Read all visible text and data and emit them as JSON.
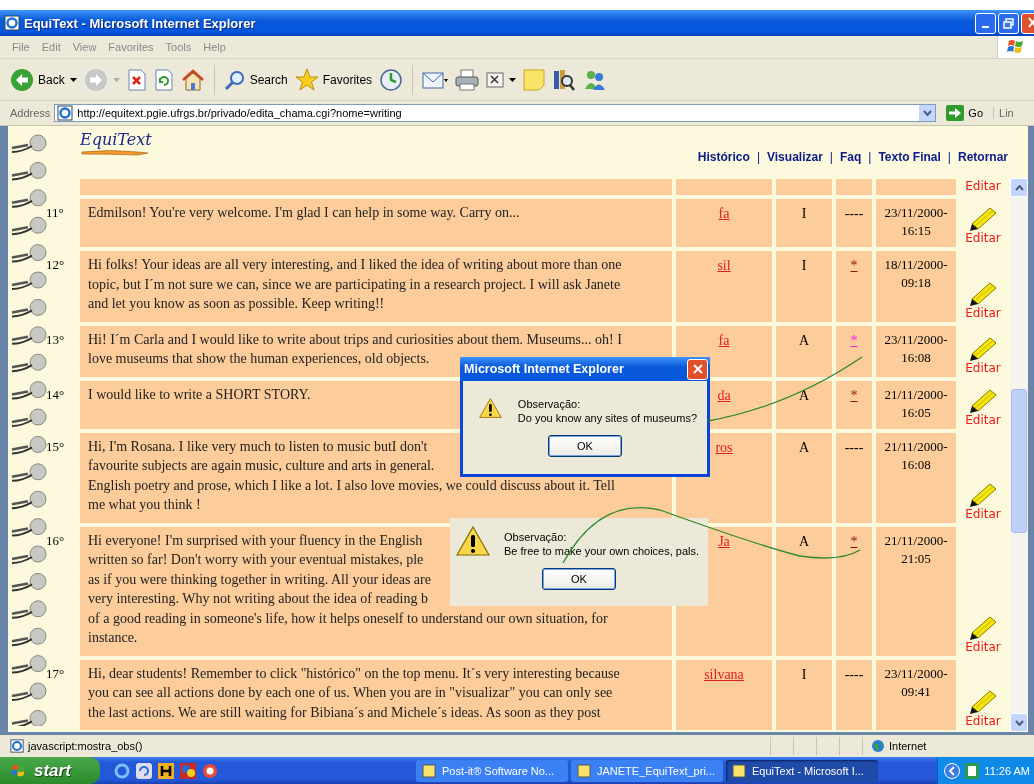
{
  "window": {
    "title": "EquiText - Microsoft Internet Explorer"
  },
  "menu": [
    "File",
    "Edit",
    "View",
    "Favorites",
    "Tools",
    "Help"
  ],
  "toolbar": {
    "back": "Back",
    "search": "Search",
    "favorites": "Favorites"
  },
  "address": {
    "label": "Address",
    "url": "http://equitext.pgie.ufrgs.br/privado/edita_chama.cgi?nome=writing",
    "go": "Go",
    "links": "Lin"
  },
  "page": {
    "logo": "EquiText",
    "nav": [
      {
        "kind": "link",
        "label": "Histórico"
      },
      {
        "kind": "separator",
        "label": "|"
      },
      {
        "kind": "link",
        "label": "Visualizar"
      },
      {
        "kind": "separator",
        "label": "|"
      },
      {
        "kind": "link",
        "label": "Faq"
      },
      {
        "kind": "separator",
        "label": "|"
      },
      {
        "kind": "link",
        "label": "Texto Final"
      },
      {
        "kind": "separator",
        "label": "|"
      },
      {
        "kind": "link",
        "label": "Retornar"
      }
    ],
    "partial_row": {
      "edit": "Editar"
    },
    "rows": [
      {
        "number": "11°",
        "lines": [
          "Edmilson! You're very welcome. I'm glad I can help in some way. Carry on..."
        ],
        "author": "fa",
        "type": "I",
        "obs": {
          "kind": "none",
          "text": "----"
        },
        "date": [
          "23/11/2000-",
          "16:15"
        ],
        "edit": "Editar"
      },
      {
        "number": "12°",
        "lines": [
          "Hi folks! Your ideas are all very interesting, and I liked the idea of writing about more than one",
          "topic, but I´m not sure we can, since we are participating in a research project. I will ask Janete",
          "and let you know as soon as possible. Keep writing!!"
        ],
        "author": "sil",
        "type": "I",
        "obs": {
          "kind": "link",
          "text": "*",
          "highlighted": false
        },
        "date": [
          "18/11/2000-",
          "09:18"
        ],
        "edit": "Editar"
      },
      {
        "number": "13°",
        "lines": [
          "Hi! I´m Carla and I would like to write about trips and curiosities about them. Museums... oh! I",
          "love museums that show the human experiences, old objects."
        ],
        "author": "fa",
        "type": "A",
        "obs": {
          "kind": "link",
          "text": "*",
          "highlighted": true
        },
        "date": [
          "23/11/2000-",
          "16:08"
        ],
        "edit": "Editar"
      },
      {
        "number": "14°",
        "lines": [
          "I would like to write a SHORT STORY."
        ],
        "author": "da",
        "type": "A",
        "obs": {
          "kind": "link",
          "text": "*",
          "highlighted": false
        },
        "date": [
          "21/11/2000-",
          "16:05"
        ],
        "edit": "Editar"
      },
      {
        "number": "15°",
        "lines": [
          "Hi, I'm Rosana. I like very much to listen to music butI don't",
          "favourite subjects are again music, culture and arts in general.",
          "English poetry and prose, which I like a lot. I also love movies, we could discuss about it. Tell",
          "me what you think !"
        ],
        "author": "ros",
        "type": "A",
        "obs": {
          "kind": "none",
          "text": "----"
        },
        "date": [
          "21/11/2000-",
          "16:08"
        ],
        "edit": "Editar"
      },
      {
        "number": "16°",
        "lines": [
          "Hi everyone! I'm surprised with your fluency in the English",
          "written so far! Don't worry with your eventual mistakes, ple",
          "as if you were thinking together in writing. All your ideas are",
          "very interesting. Why not writing about the idea of reading b",
          "of a good reading in someone's life, how it helps oneself to understand our own situation, for",
          "instance."
        ],
        "author": "Ja",
        "type": "A",
        "obs": {
          "kind": "link",
          "text": "*",
          "highlighted": false
        },
        "date": [
          "21/11/2000-",
          "21:05"
        ],
        "edit": "Editar"
      },
      {
        "number": "17°",
        "lines": [
          "Hi, dear students! Remember to click \"histórico\" on the top menu. It´s very interesting because",
          "you can see all actions done by each one of us. When you are in \"visualizar\" you can only see",
          "the last actions. We are still waiting for Bibiana´s and Michele´s ideas. As soon as they post"
        ],
        "author": "silvana",
        "type": "I",
        "obs": {
          "kind": "none",
          "text": "----"
        },
        "date": [
          "23/11/2000-",
          "09:41"
        ],
        "edit": "Editar"
      }
    ]
  },
  "dialogs": [
    {
      "kind": "window",
      "title": "Microsoft Internet Explorer",
      "heading": "Observação:",
      "message": "Do you know any sites of museums?",
      "button": "OK"
    },
    {
      "kind": "clip",
      "heading": "Observação:",
      "message": "Be free to make your own choices, pals.",
      "button": "OK"
    }
  ],
  "status_bar": {
    "text": "javascript:mostra_obs()",
    "zone": "Internet"
  },
  "taskbar": {
    "start": "start",
    "tasks": [
      {
        "label": "Post-it® Software No...",
        "selected": false
      },
      {
        "label": "JANETE_EquiText_pri...",
        "selected": false
      },
      {
        "label": "EquiText - Microsoft I...",
        "selected": true
      }
    ],
    "clock": "11:26 AM"
  }
}
